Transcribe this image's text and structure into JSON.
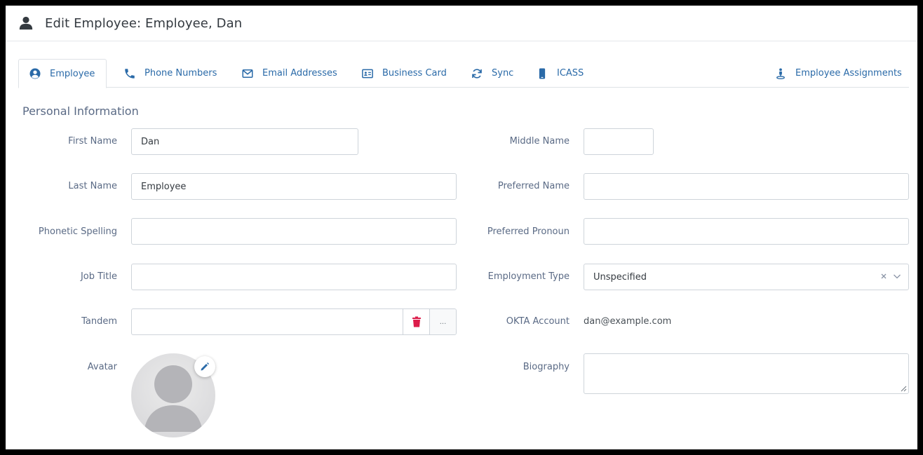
{
  "header": {
    "title": "Edit Employee: Employee, Dan"
  },
  "tabs": [
    {
      "label": "Employee",
      "icon": "user-circle-icon",
      "active": true
    },
    {
      "label": "Phone Numbers",
      "icon": "phone-icon"
    },
    {
      "label": "Email Addresses",
      "icon": "envelope-icon"
    },
    {
      "label": "Business Card",
      "icon": "id-card-icon"
    },
    {
      "label": "Sync",
      "icon": "sync-icon"
    },
    {
      "label": "ICASS",
      "icon": "mobile-icon"
    },
    {
      "label": "Employee Assignments",
      "icon": "person-pin-icon"
    }
  ],
  "section": {
    "title": "Personal Information"
  },
  "form": {
    "first_name": {
      "label": "First Name",
      "value": "Dan"
    },
    "middle_name": {
      "label": "Middle Name",
      "value": ""
    },
    "last_name": {
      "label": "Last Name",
      "value": "Employee"
    },
    "preferred_name": {
      "label": "Preferred Name",
      "value": ""
    },
    "phonetic_spelling": {
      "label": "Phonetic Spelling",
      "value": ""
    },
    "preferred_pronoun": {
      "label": "Preferred Pronoun",
      "value": ""
    },
    "job_title": {
      "label": "Job Title",
      "value": ""
    },
    "employment_type": {
      "label": "Employment Type",
      "value": "Unspecified"
    },
    "tandem": {
      "label": "Tandem",
      "value": "",
      "more_label": "..."
    },
    "okta_account": {
      "label": "OKTA Account",
      "value": "dan@example.com"
    },
    "avatar": {
      "label": "Avatar"
    },
    "biography": {
      "label": "Biography",
      "value": ""
    }
  },
  "colors": {
    "accent": "#2a6aa8",
    "danger": "#dc1c4a",
    "label": "#5a6a85"
  }
}
